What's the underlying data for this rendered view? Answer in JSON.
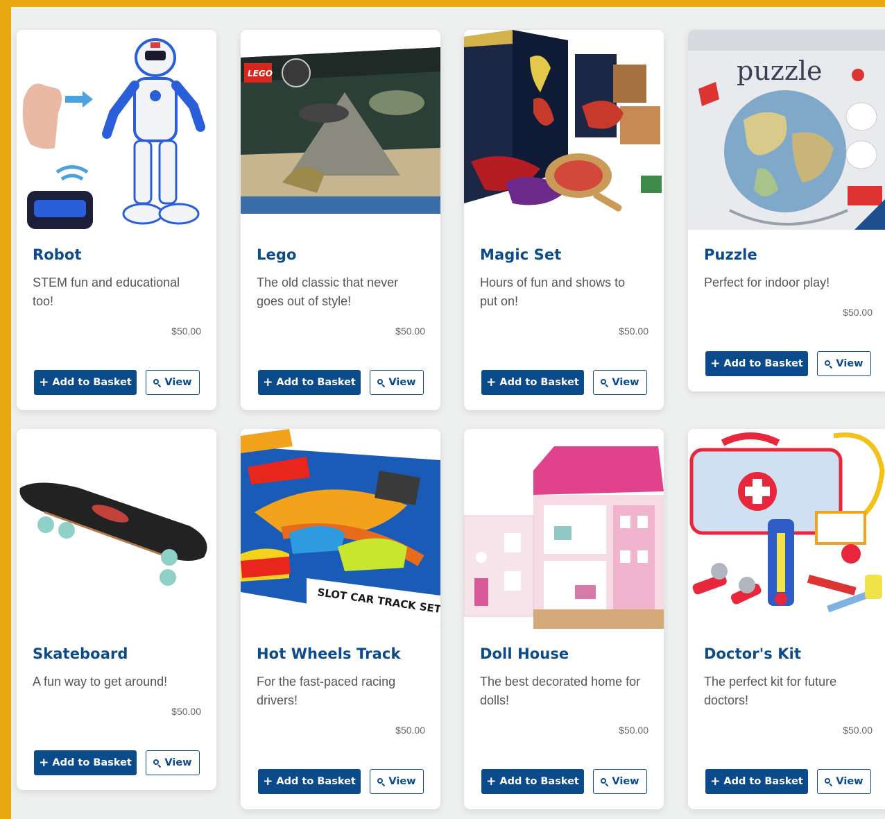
{
  "colors": {
    "frame": "#e8a912",
    "accent": "#0b4a8b",
    "page_bg": "#eeefef",
    "card_bg": "#ffffff"
  },
  "buttons": {
    "add_label": "Add to Basket",
    "view_label": "View",
    "add_icon": "plus-icon",
    "view_icon": "search-icon"
  },
  "products": [
    {
      "title": "Robot",
      "description": "STEM fun and educational too!",
      "price": "$50.00",
      "image": "robot-image"
    },
    {
      "title": "Lego",
      "description": "The old classic that never goes out of style!",
      "price": "$50.00",
      "image": "lego-image"
    },
    {
      "title": "Magic Set",
      "description": "Hours of fun and shows to put on!",
      "price": "$50.00",
      "image": "magic-set-image"
    },
    {
      "title": "Puzzle",
      "description": "Perfect for indoor play!",
      "price": "$50.00",
      "image": "puzzle-image",
      "image_text": "puzzle"
    },
    {
      "title": "Skateboard",
      "description": "A fun way to get around!",
      "price": "$50.00",
      "image": "skateboard-image"
    },
    {
      "title": "Hot Wheels Track",
      "description": "For the fast-paced racing drivers!",
      "price": "$50.00",
      "image": "hot-wheels-image",
      "image_text": "SLOT CAR TRACK SET"
    },
    {
      "title": "Doll House",
      "description": "The best decorated home for dolls!",
      "price": "$50.00",
      "image": "doll-house-image"
    },
    {
      "title": "Doctor's Kit",
      "description": "The perfect kit for future doctors!",
      "price": "$50.00",
      "image": "doctors-kit-image"
    }
  ]
}
